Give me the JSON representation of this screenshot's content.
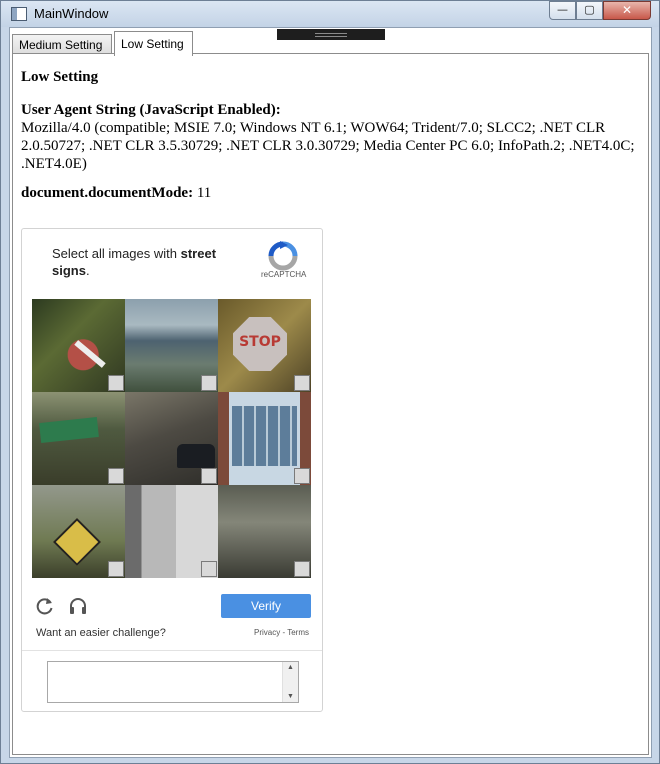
{
  "window": {
    "title": "MainWindow",
    "controls": {
      "minimize": "—",
      "maximize": "▢",
      "close": "✕"
    }
  },
  "tabs": [
    {
      "label": "Medium Setting",
      "selected": false
    },
    {
      "label": "Low Setting",
      "selected": true
    }
  ],
  "page": {
    "heading": "Low Setting",
    "ua_label": "User Agent String (JavaScript Enabled):",
    "ua_value": "Mozilla/4.0 (compatible; MSIE 7.0; Windows NT 6.1; WOW64; Trident/7.0; SLCC2; .NET CLR 2.0.50727; .NET CLR 3.5.30729; .NET CLR 3.0.30729; Media Center PC 6.0; InfoPath.2; .NET4.0C; .NET4.0E)",
    "mode_label": "document.documentMode:",
    "mode_value": "11"
  },
  "captcha": {
    "prompt_prefix": "Select all images with ",
    "prompt_target": "street signs",
    "prompt_suffix": ".",
    "brand": "reCAPTCHA",
    "tiles": [
      {
        "name": "no-entry-sign",
        "selected": false
      },
      {
        "name": "coastline",
        "selected": false
      },
      {
        "name": "stop-sign",
        "selected": false
      },
      {
        "name": "street-name-sign",
        "selected": false
      },
      {
        "name": "road-with-car",
        "selected": false
      },
      {
        "name": "glass-building",
        "selected": false
      },
      {
        "name": "yellow-diamond-sign",
        "selected": false
      },
      {
        "name": "pole-closeup",
        "selected": false
      },
      {
        "name": "hillside-street",
        "selected": false
      }
    ],
    "verify_label": "Verify",
    "easier_label": "Want an easier challenge?",
    "privacy_label": "Privacy",
    "separator": " - ",
    "terms_label": "Terms",
    "accent_color": "#4a90e2",
    "icons": {
      "reload": "reload-icon",
      "audio": "headphones-icon"
    }
  }
}
